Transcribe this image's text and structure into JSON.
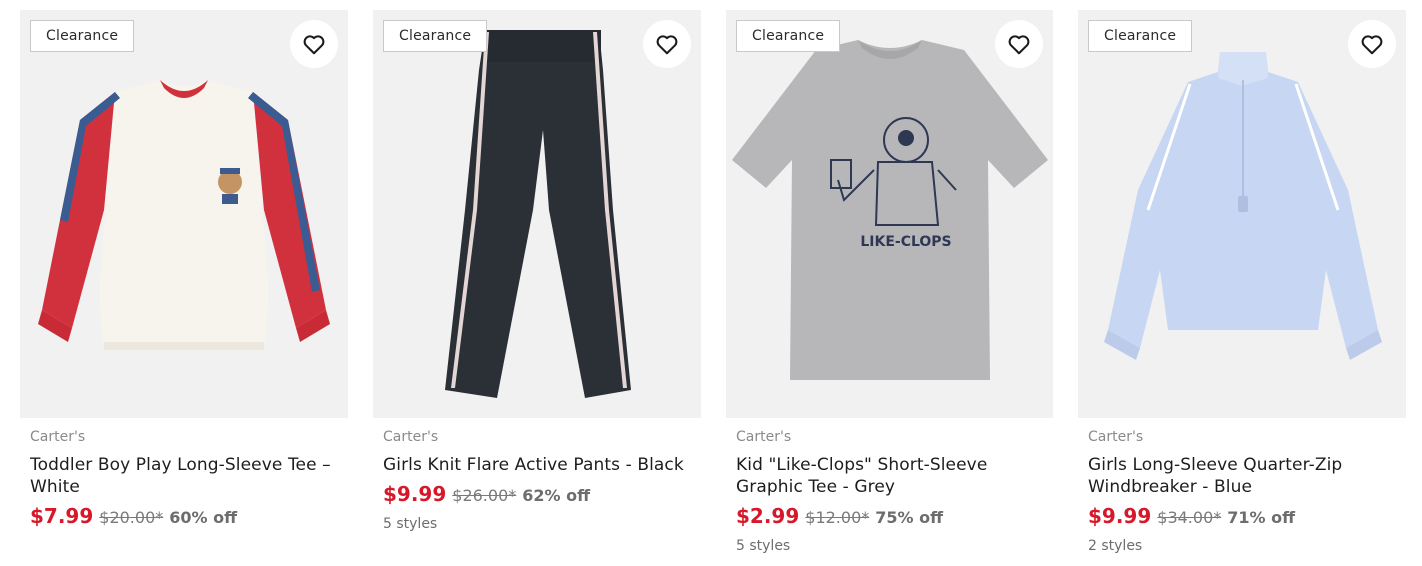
{
  "products": [
    {
      "badge": "Clearance",
      "brand": "Carter's",
      "title": "Toddler Boy Play Long-Sleeve Tee – White",
      "sale_price": "$7.99",
      "original_price": "$20.00*",
      "discount": "60% off",
      "styles": "",
      "favorite_icon": "heart-outline-icon"
    },
    {
      "badge": "Clearance",
      "brand": "Carter's",
      "title": "Girls Knit Flare Active Pants - Black",
      "sale_price": "$9.99",
      "original_price": "$26.00*",
      "discount": "62% off",
      "styles": "5 styles",
      "favorite_icon": "heart-outline-icon"
    },
    {
      "badge": "Clearance",
      "brand": "Carter's",
      "title": "Kid \"Like-Clops\" Short-Sleeve Graphic Tee - Grey",
      "sale_price": "$2.99",
      "original_price": "$12.00*",
      "discount": "75% off",
      "styles": "5 styles",
      "graphic_text": "LIKE-CLOPS",
      "favorite_icon": "heart-outline-icon"
    },
    {
      "badge": "Clearance",
      "brand": "Carter's",
      "title": "Girls Long-Sleeve Quarter-Zip Windbreaker - Blue",
      "sale_price": "$9.99",
      "original_price": "$34.00*",
      "discount": "71% off",
      "styles": "2 styles",
      "favorite_icon": "heart-outline-icon"
    }
  ],
  "colors": {
    "sale_price": "#d7182a",
    "image_bg": "#f1f1f1",
    "text": "#1d1d1d",
    "muted": "#8a8a8a"
  }
}
